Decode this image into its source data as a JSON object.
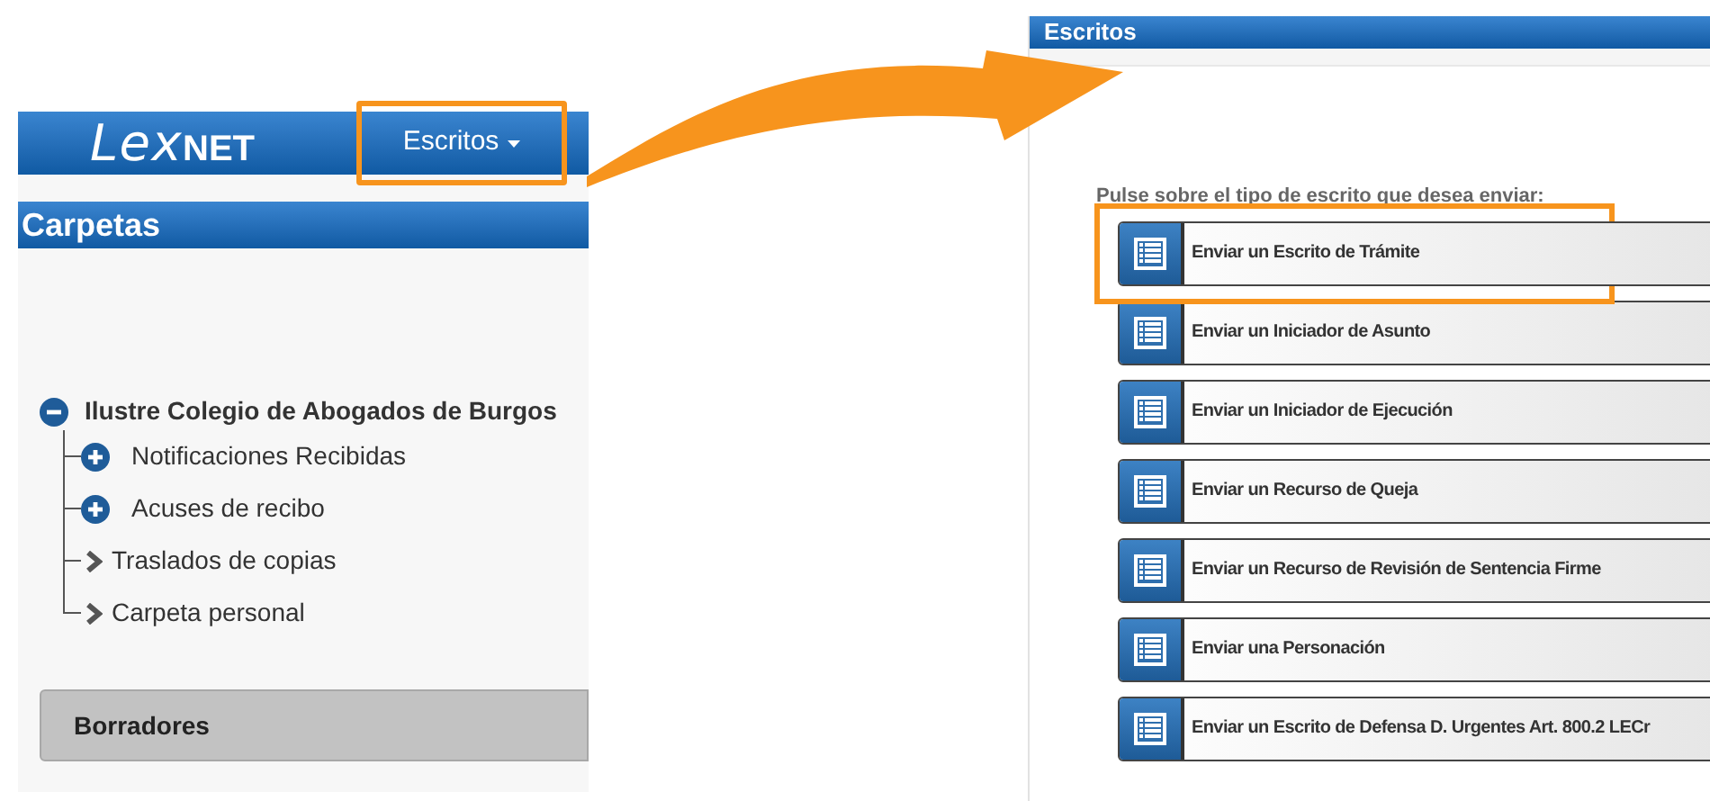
{
  "left_screen": {
    "logo": {
      "script_part": "Lex",
      "bold_part": "NET"
    },
    "nav_button": {
      "label": "Escritos",
      "highlighted": true
    },
    "section_title": "Carpetas",
    "tree": {
      "label": "Ilustre Colegio de Abogados de Burgos",
      "expanded": true,
      "children": [
        {
          "label": "Notificaciones Recibidas",
          "kind": "expandable"
        },
        {
          "label": "Acuses de recibo",
          "kind": "expandable"
        },
        {
          "label": "Traslados de copias",
          "kind": "link"
        },
        {
          "label": "Carpeta personal",
          "kind": "link"
        }
      ]
    },
    "drafts_bar": "Borradores"
  },
  "right_screen": {
    "title": "Escritos",
    "instruction": "Pulse sobre el tipo de escrito que desea enviar:",
    "options": [
      {
        "label": "Enviar un Escrito de Trámite",
        "highlighted": true
      },
      {
        "label": "Enviar un Iniciador de Asunto",
        "highlighted": false
      },
      {
        "label": "Enviar un Iniciador de Ejecución",
        "highlighted": false
      },
      {
        "label": "Enviar un Recurso de Queja",
        "highlighted": false
      },
      {
        "label": "Enviar un Recurso de Revisión de Sentencia Firme",
        "highlighted": false
      },
      {
        "label": "Enviar una Personación",
        "highlighted": false
      },
      {
        "label": "Enviar un Escrito de Defensa D. Urgentes Art. 800.2 LECr",
        "highlighted": false
      }
    ]
  }
}
